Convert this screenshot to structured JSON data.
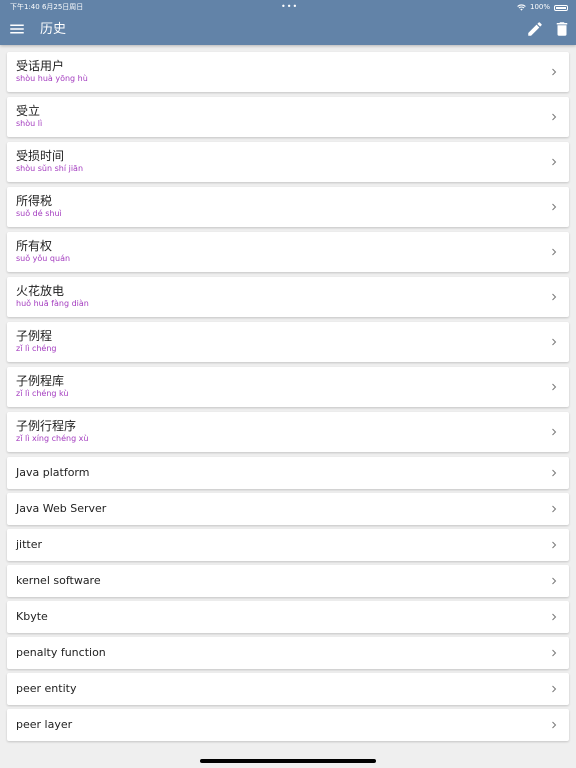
{
  "status_bar": {
    "time_date": "下午1:40  6月25日周日",
    "dots": "•••",
    "battery": "100%"
  },
  "header": {
    "title": "历史",
    "icons": [
      "menu-icon",
      "edit-icon",
      "delete-icon"
    ]
  },
  "colors": {
    "header": "#6283a8",
    "pinyin": "#a33bbf",
    "background": "#efefef"
  },
  "history": [
    {
      "term": "受话用户",
      "pinyin": "shòu huà yōng hù"
    },
    {
      "term": "受立",
      "pinyin": "shòu lì"
    },
    {
      "term": "受损时间",
      "pinyin": "shòu sǔn shí jiān"
    },
    {
      "term": "所得税",
      "pinyin": "suǒ dé shuì"
    },
    {
      "term": "所有权",
      "pinyin": "suǒ yǒu quán"
    },
    {
      "term": "火花放电",
      "pinyin": "huǒ huā fàng diàn"
    },
    {
      "term": "子例程",
      "pinyin": "zǐ lì chéng"
    },
    {
      "term": "子例程库",
      "pinyin": "zǐ lì chéng kù"
    },
    {
      "term": "子例行程序",
      "pinyin": "zǐ lì xíng chéng xù"
    },
    {
      "term": "Java platform"
    },
    {
      "term": "Java Web Server"
    },
    {
      "term": "jitter"
    },
    {
      "term": "kernel software"
    },
    {
      "term": "Kbyte"
    },
    {
      "term": "penalty function"
    },
    {
      "term": "peer entity"
    },
    {
      "term": "peer layer"
    }
  ]
}
